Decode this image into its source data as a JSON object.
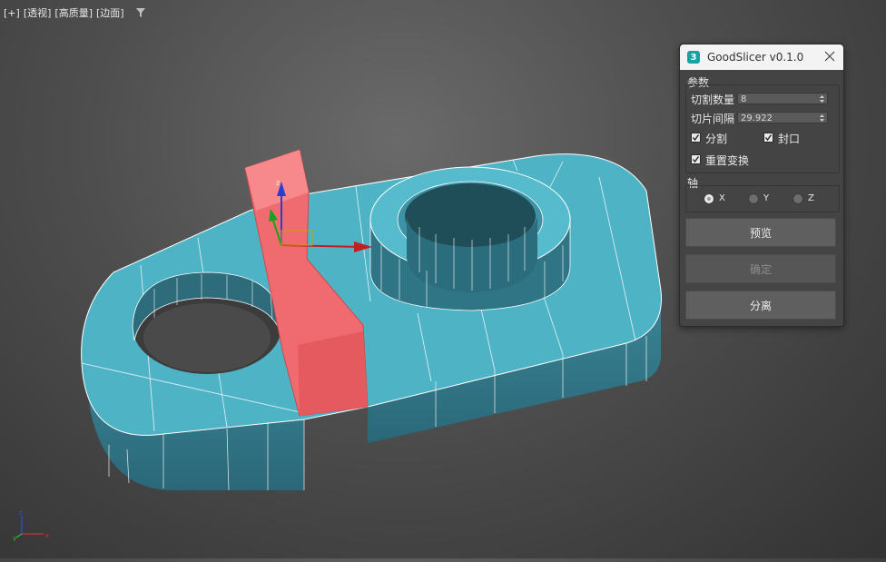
{
  "viewport": {
    "labels": [
      "[+]",
      "[透视]",
      "[高质量]",
      "[边面]"
    ],
    "filter_icon": "filter-icon",
    "axis_labels": {
      "x": "x",
      "y": "y",
      "z": "z"
    },
    "gizmo_label": "z"
  },
  "dialog": {
    "title": "GoodSlicer v0.1.0",
    "app_icon_text": "3",
    "params_group": "参数",
    "cut_count_label": "切割数量",
    "cut_count_value": "8",
    "slice_spacing_label": "切片间隔",
    "slice_spacing_value": "29.922",
    "split_label": "分割",
    "split_checked": true,
    "cap_label": "封口",
    "cap_checked": true,
    "reset_xform_label": "重置变换",
    "reset_xform_checked": true,
    "axis_group": "轴",
    "axis_options": [
      "X",
      "Y",
      "Z"
    ],
    "axis_selected": "X",
    "preview_button": "预览",
    "confirm_button": "确定",
    "confirm_enabled": false,
    "separate_button": "分离"
  },
  "colors": {
    "model": "#4fb3c6",
    "slicer_box": "#f06b6f",
    "panel_bg": "#444444",
    "titlebar_bg": "#f3f3f3"
  }
}
